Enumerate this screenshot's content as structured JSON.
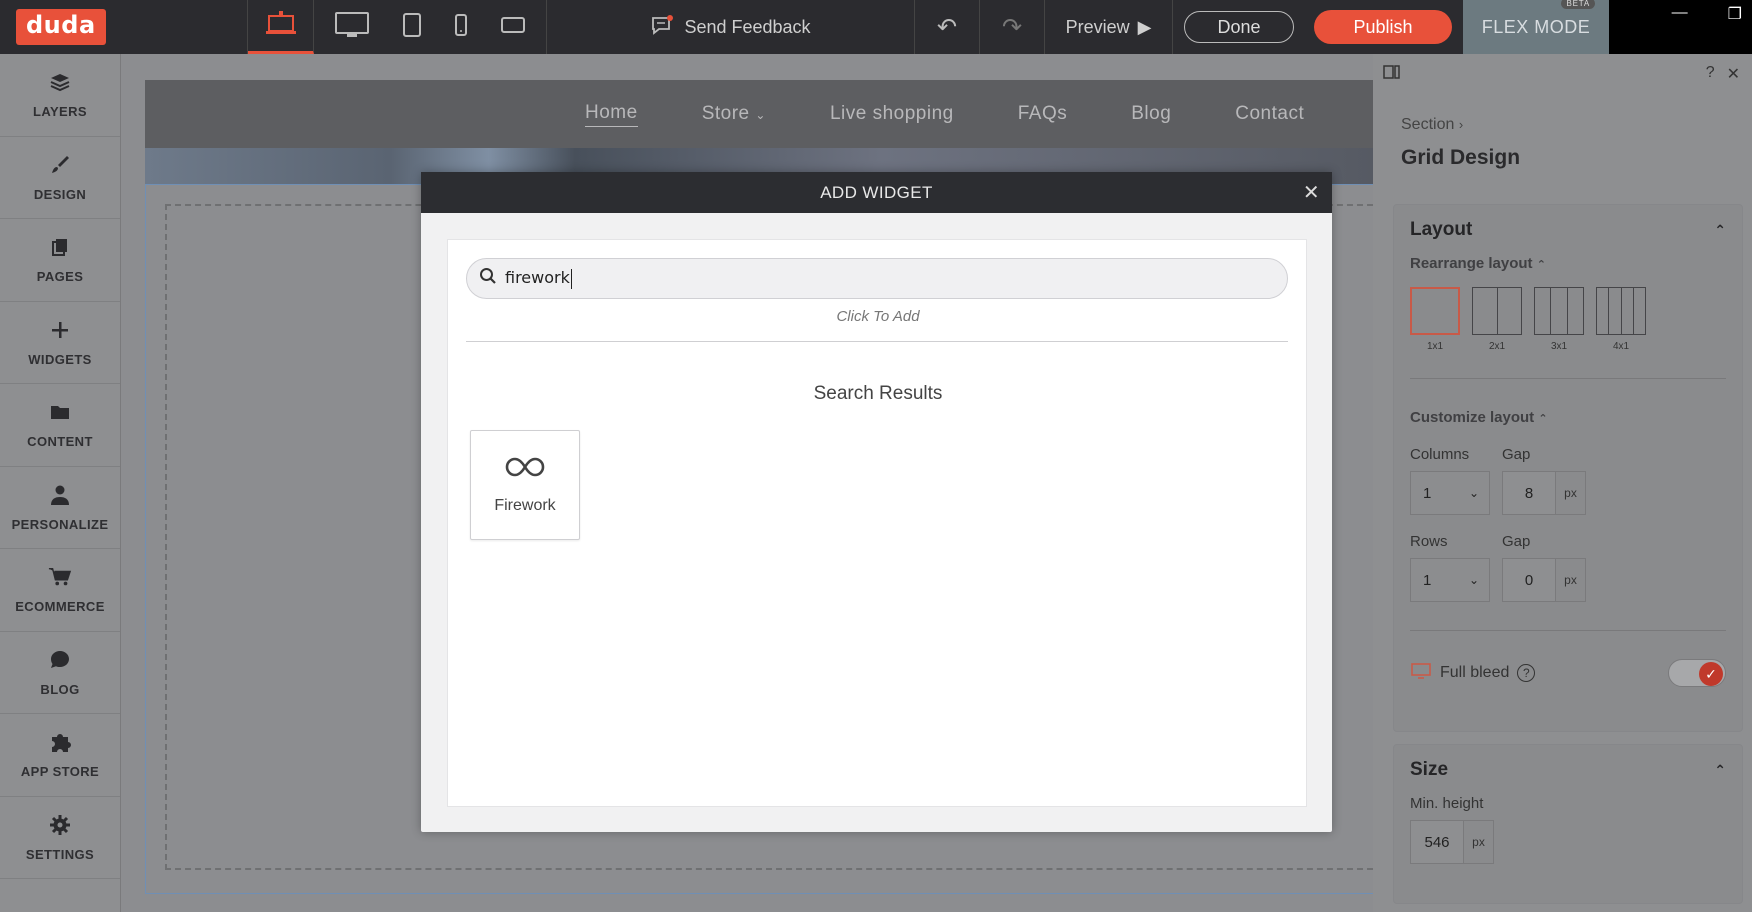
{
  "topbar": {
    "logo": "duda",
    "send_feedback": "Send Feedback",
    "preview": "Preview",
    "done": "Done",
    "publish": "Publish",
    "flex_mode": "FLEX MODE",
    "beta": "BETA",
    "accent_color": "#e8513a"
  },
  "sidebar": {
    "items": [
      {
        "label": "LAYERS",
        "icon": "layers-icon"
      },
      {
        "label": "DESIGN",
        "icon": "brush-icon"
      },
      {
        "label": "PAGES",
        "icon": "pages-icon"
      },
      {
        "label": "WIDGETS",
        "icon": "plus-icon"
      },
      {
        "label": "CONTENT",
        "icon": "folder-icon"
      },
      {
        "label": "PERSONALIZE",
        "icon": "person-icon"
      },
      {
        "label": "ECOMMERCE",
        "icon": "cart-icon"
      },
      {
        "label": "BLOG",
        "icon": "chat-bubble-icon"
      },
      {
        "label": "APP STORE",
        "icon": "puzzle-icon"
      },
      {
        "label": "SETTINGS",
        "icon": "gear-icon"
      }
    ]
  },
  "site_nav": {
    "items": [
      "Home",
      "Store",
      "Live shopping",
      "FAQs",
      "Blog",
      "Contact"
    ]
  },
  "modal": {
    "title": "ADD WIDGET",
    "search_value": "firework",
    "hint": "Click To Add",
    "results_heading": "Search Results",
    "results": [
      {
        "label": "Firework",
        "icon": "infinity-icon"
      }
    ]
  },
  "panel": {
    "breadcrumb": "Section",
    "title": "Grid Design",
    "layout": {
      "heading": "Layout",
      "rearrange": "Rearrange layout",
      "options": [
        "1x1",
        "2x1",
        "3x1",
        "4x1"
      ],
      "selected": "1x1",
      "customize": "Customize layout",
      "columns_label": "Columns",
      "columns_value": "1",
      "col_gap_label": "Gap",
      "col_gap_value": "8",
      "rows_label": "Rows",
      "rows_value": "1",
      "row_gap_label": "Gap",
      "row_gap_value": "0",
      "unit": "px",
      "full_bleed": "Full bleed",
      "full_bleed_on": true
    },
    "size": {
      "heading": "Size",
      "min_height_label": "Min. height",
      "min_height_value": "546",
      "unit": "px"
    }
  }
}
